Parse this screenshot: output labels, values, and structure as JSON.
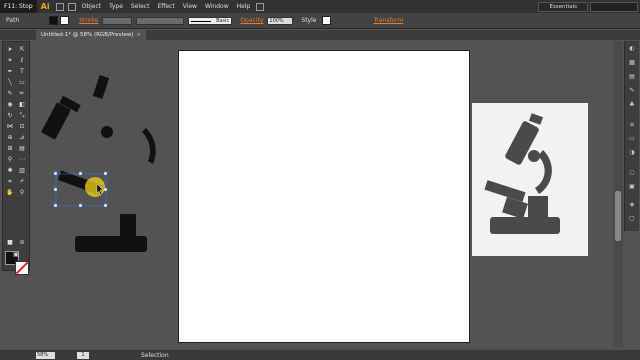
{
  "menubar": {
    "stop_label": "F11: Stop",
    "logo": "Ai",
    "menus": [
      "Object",
      "Type",
      "Select",
      "Effect",
      "View",
      "Window",
      "Help"
    ],
    "workspace": "Essentials"
  },
  "control": {
    "selection_type": "Path",
    "stroke_label": "Stroke",
    "brush_label": "Basic",
    "opacity_label": "Opacity",
    "opacity_value": "100%",
    "style_label": "Style",
    "transform_label": "Transform"
  },
  "document": {
    "tab_title": "Untitled-1* @ 58% (RGB/Preview)",
    "close": "×"
  },
  "status": {
    "zoom": "58%",
    "page": "1",
    "tool": "Selection"
  },
  "colors": {
    "accent": "#e87b2a",
    "selection": "#3a6fd8",
    "cursor_highlight": "#f2d21b"
  }
}
